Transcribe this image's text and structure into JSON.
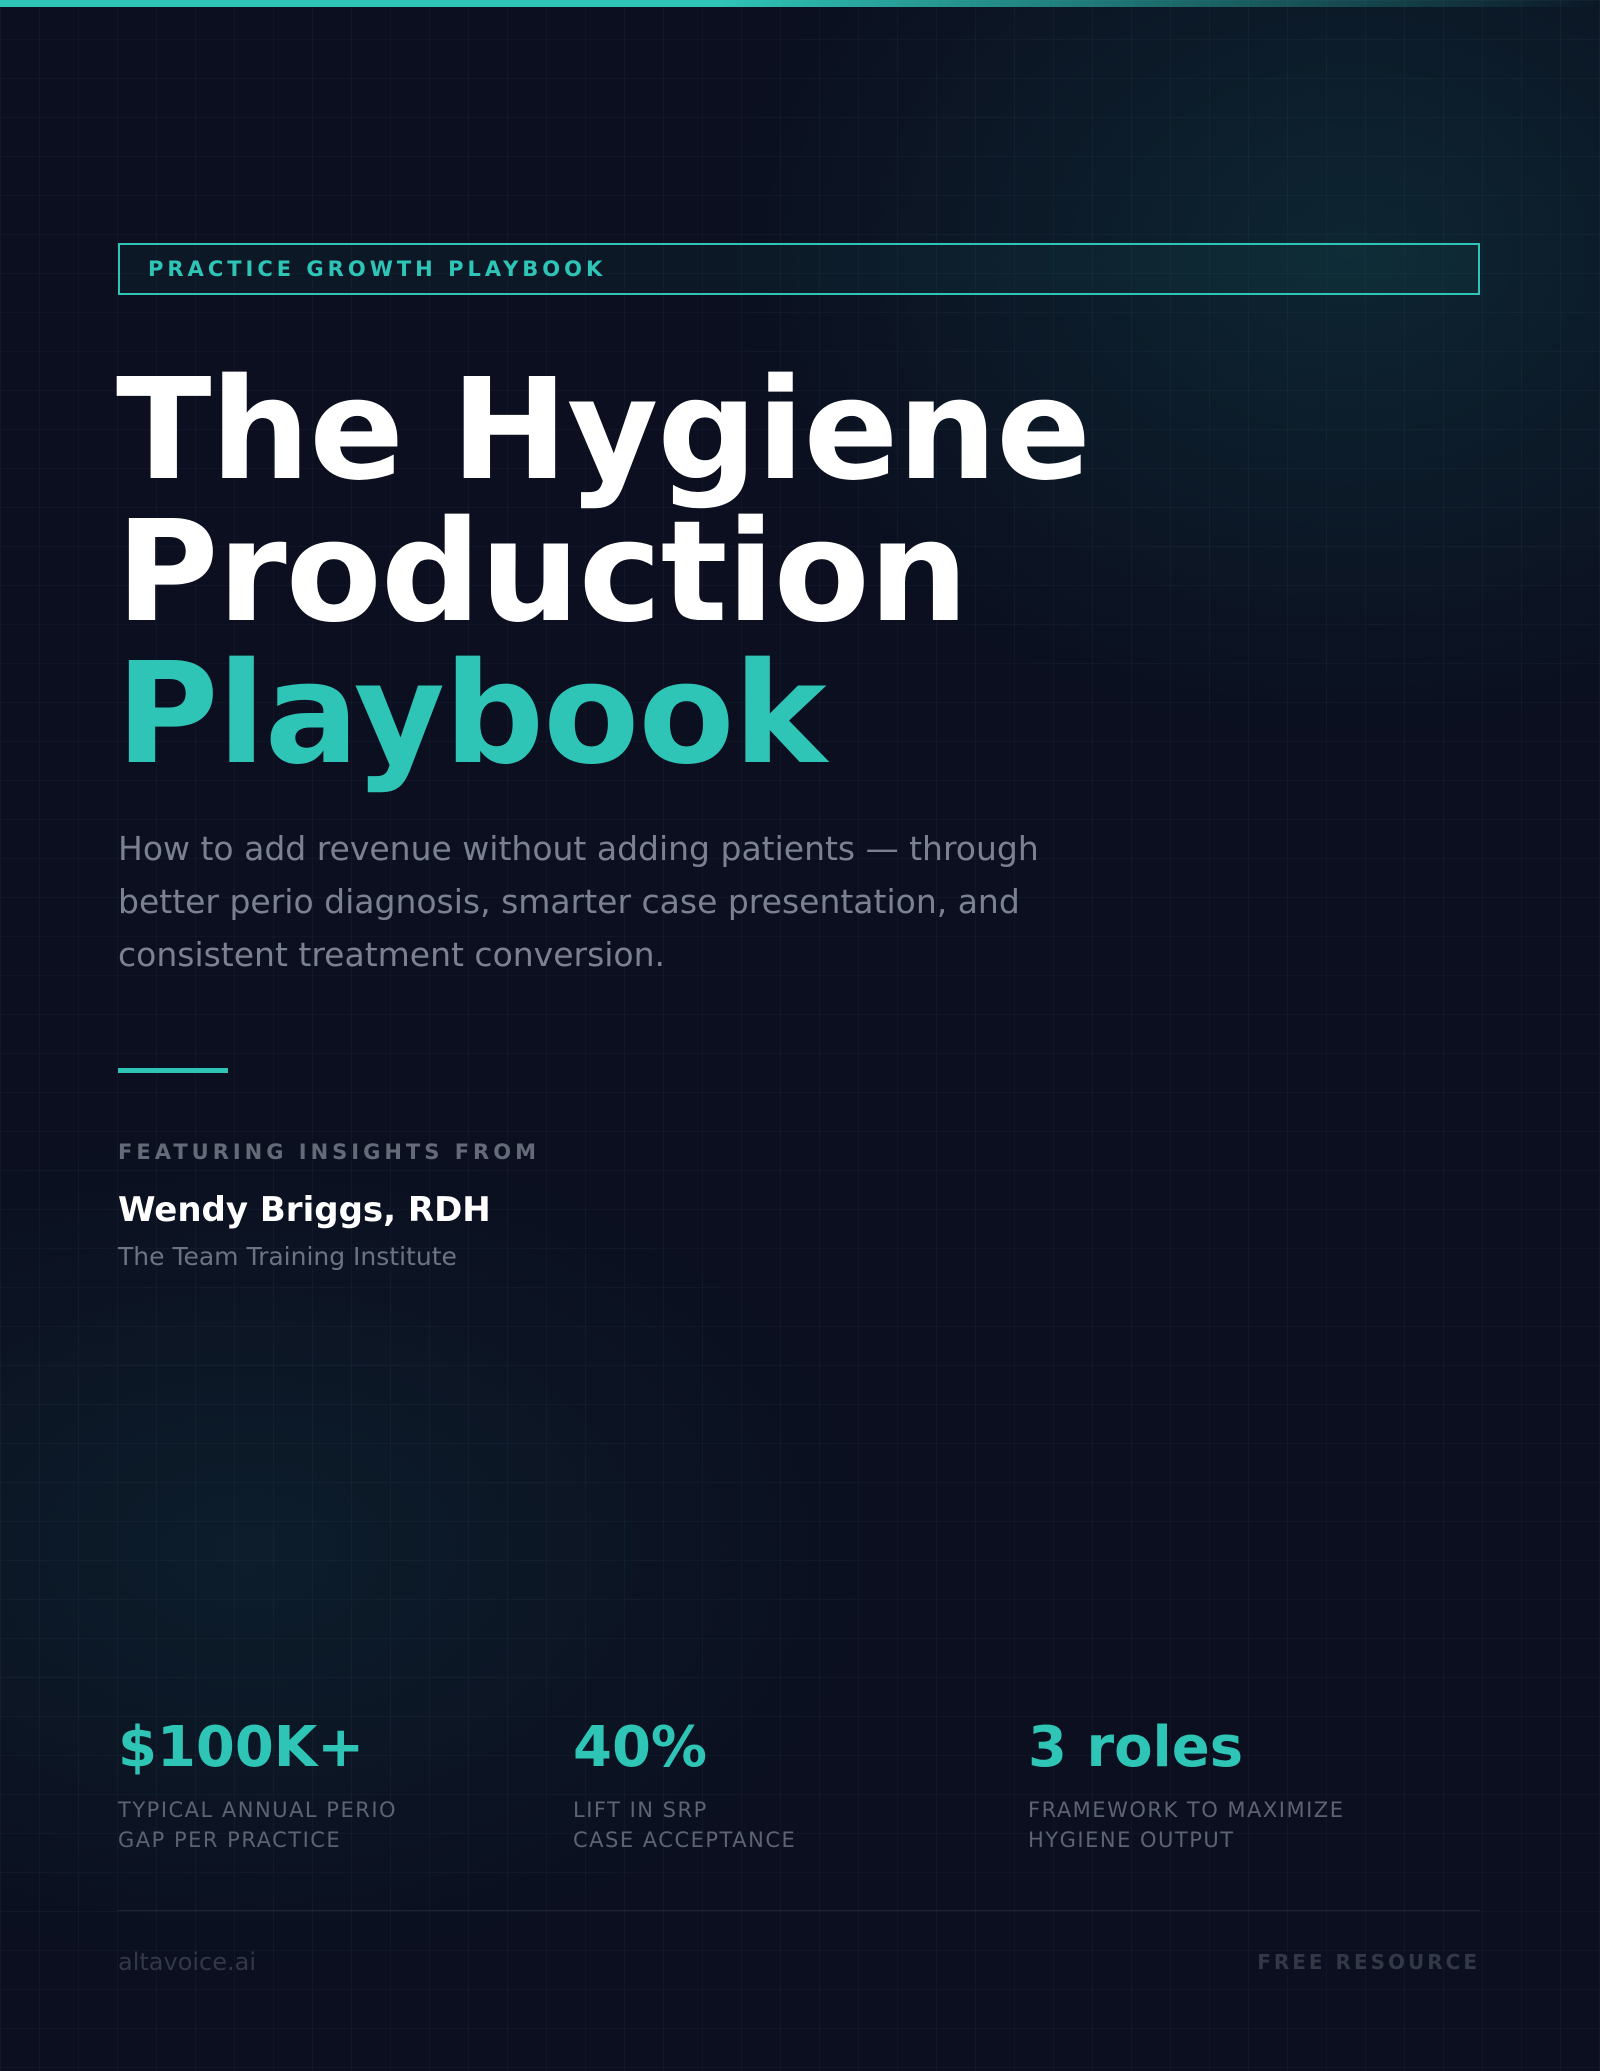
{
  "header": {
    "eyebrow": "PRACTICE GROWTH PLAYBOOK"
  },
  "title": {
    "line1": "The Hygiene",
    "line2": "Production",
    "line3": "Playbook"
  },
  "subtitle": "How to add revenue without adding patients — through better perio diagnosis, smarter case presentation, and consistent treatment conversion.",
  "featuring": {
    "label": "FEATURING INSIGHTS FROM",
    "name": "Wendy Briggs, RDH",
    "organization": "The Team Training Institute"
  },
  "stats": [
    {
      "value": "$100K+",
      "label_line1": "TYPICAL ANNUAL PERIO",
      "label_line2": "GAP PER PRACTICE"
    },
    {
      "value": "40%",
      "label_line1": "LIFT IN SRP",
      "label_line2": "CASE ACCEPTANCE"
    },
    {
      "value": "3 roles",
      "label_line1": "FRAMEWORK TO MAXIMIZE",
      "label_line2": "HYGIENE OUTPUT"
    }
  ],
  "footer": {
    "left": "altavoice.ai",
    "right": "FREE RESOURCE"
  },
  "colors": {
    "background": "#0b0f1f",
    "accent": "#2ec4b6",
    "title": "#ffffff",
    "muted": "#7b8190"
  }
}
